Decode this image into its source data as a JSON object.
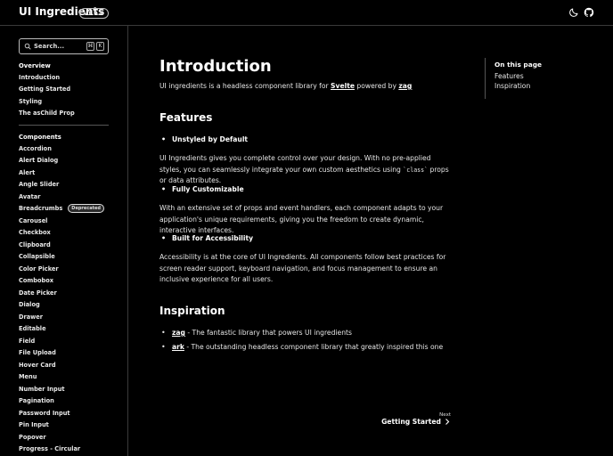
{
  "header": {
    "brand": "UI Ingredients",
    "version": "v1.9.0",
    "icons": [
      "moon-icon",
      "github-icon"
    ]
  },
  "sidebar": {
    "search_placeholder": "Search...",
    "shortcut": [
      "⌘",
      "K"
    ],
    "overview_title": "Overview",
    "overview_items": [
      "Introduction",
      "Getting Started",
      "Styling",
      "The asChild Prop"
    ],
    "components_title": "Components",
    "components_items": [
      {
        "label": "Accordion"
      },
      {
        "label": "Alert Dialog"
      },
      {
        "label": "Alert"
      },
      {
        "label": "Angle Slider"
      },
      {
        "label": "Avatar"
      },
      {
        "label": "Breadcrumbs",
        "badge": "Deprecated"
      },
      {
        "label": "Carousel"
      },
      {
        "label": "Checkbox"
      },
      {
        "label": "Clipboard"
      },
      {
        "label": "Collapsible"
      },
      {
        "label": "Color Picker"
      },
      {
        "label": "Combobox"
      },
      {
        "label": "Date Picker"
      },
      {
        "label": "Dialog"
      },
      {
        "label": "Drawer"
      },
      {
        "label": "Editable"
      },
      {
        "label": "Field"
      },
      {
        "label": "File Upload"
      },
      {
        "label": "Hover Card"
      },
      {
        "label": "Menu"
      },
      {
        "label": "Number Input"
      },
      {
        "label": "Pagination"
      },
      {
        "label": "Password Input"
      },
      {
        "label": "Pin Input"
      },
      {
        "label": "Popover"
      },
      {
        "label": "Progress - Circular"
      }
    ]
  },
  "main": {
    "title": "Introduction",
    "intro_before": "UI ingredients is a headless component library for ",
    "intro_link1": "Svelte",
    "intro_mid": " powered by ",
    "intro_link2": "zag",
    "features_title": "Features",
    "feature1_title": "Unstyled by Default",
    "feature1_text_before": "UI Ingredients gives you complete control over your design. With no pre-applied styles, you can seamlessly integrate your own custom aesthetics using ",
    "feature1_code": "`class`",
    "feature1_text_after": " props or data attributes.",
    "feature2_title": "Fully Customizable",
    "feature2_text": "With an extensive set of props and event handlers, each component adapts to your application's unique requirements, giving you the freedom to create dynamic, interactive interfaces.",
    "feature3_title": "Built for Accessibility",
    "feature3_text": "Accessibility is at the core of UI Ingredients. All components follow best practices for screen reader support, keyboard navigation, and focus management to ensure an inclusive experience for all users.",
    "inspiration_title": "Inspiration",
    "inspiration_items": [
      {
        "link": "zag",
        "text": " - The fantastic library that powers UI ingredients"
      },
      {
        "link": "ark",
        "text": " - The outstanding headless component library that greatly inspired this one"
      }
    ],
    "next_label": "Next",
    "next_title": "Getting Started"
  },
  "toc": {
    "title": "On this page",
    "items": [
      "Features",
      "Inspiration"
    ]
  }
}
